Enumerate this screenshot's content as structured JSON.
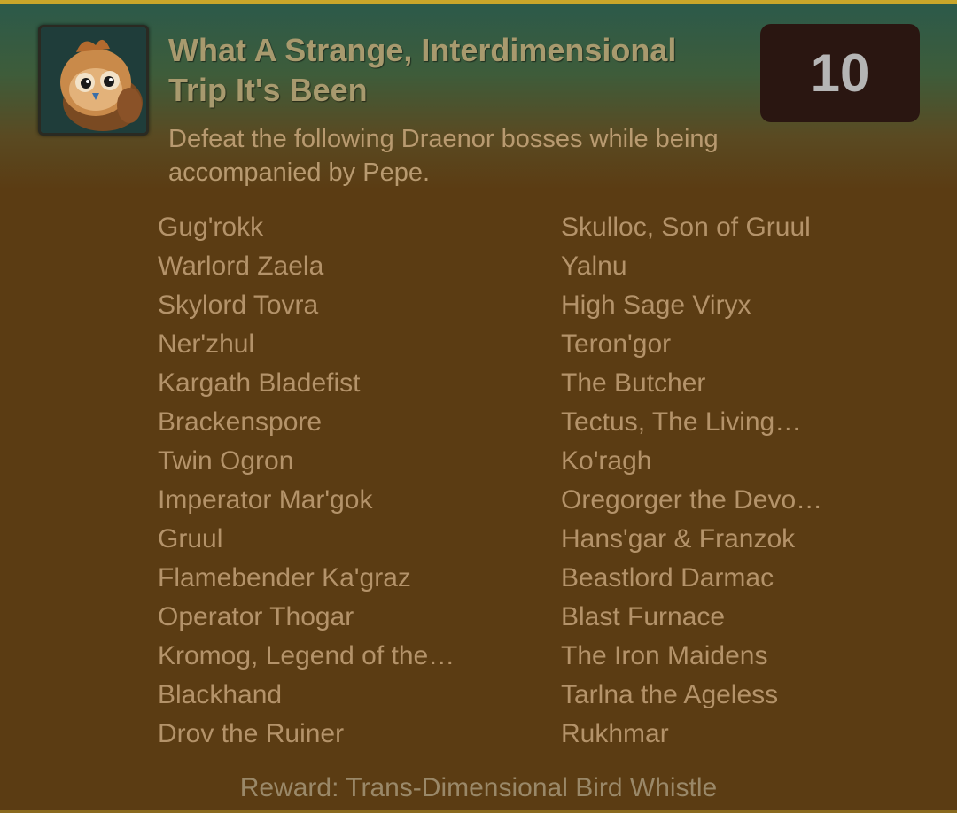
{
  "achievement": {
    "icon": "pepe-bird-icon",
    "title": "What A Strange, Interdimensional Trip It's Been",
    "points": "10",
    "description": "Defeat the following Draenor bosses while being accompanied by Pepe.",
    "reward": "Reward: Trans-Dimensional Bird Whistle"
  },
  "bosses_left": [
    "Gug'rokk",
    "Warlord Zaela",
    "Skylord Tovra",
    "Ner'zhul",
    "Kargath Bladefist",
    "Brackenspore",
    "Twin Ogron",
    "Imperator Mar'gok",
    "Gruul",
    "Flamebender Ka'graz",
    "Operator Thogar",
    "Kromog, Legend of the…",
    "Blackhand",
    "Drov the Ruiner"
  ],
  "bosses_right": [
    "Skulloc, Son of Gruul",
    "Yalnu",
    "High Sage Viryx",
    "Teron'gor",
    "The Butcher",
    "Tectus, The Living…",
    "Ko'ragh",
    "Oregorger the Devo…",
    "Hans'gar & Franzok",
    "Beastlord Darmac",
    "Blast Furnace",
    "The Iron Maidens",
    "Tarlna the Ageless",
    "Rukhmar"
  ],
  "colors": {
    "accent_border": "#c9a62a",
    "points_background": "#2a1611",
    "text": "#b4936a"
  }
}
